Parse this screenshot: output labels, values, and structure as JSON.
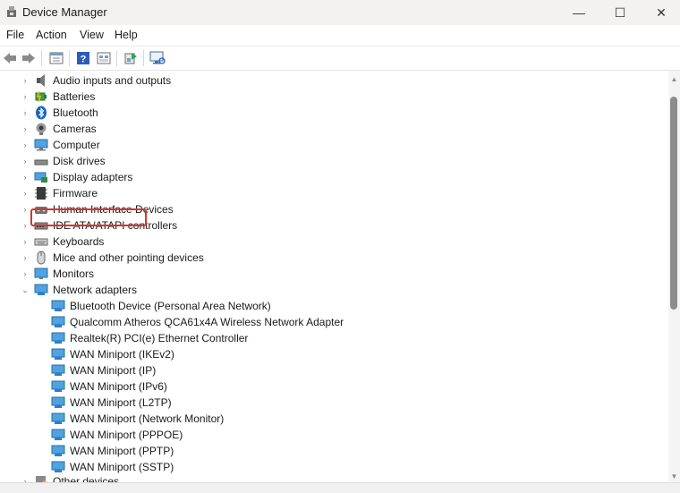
{
  "window": {
    "title": "Device Manager",
    "controls": {
      "minimize": "—",
      "maximize": "☐",
      "close": "✕"
    }
  },
  "menu": [
    "File",
    "Action",
    "View",
    "Help"
  ],
  "toolbar": {
    "buttons": [
      "back-arrow-icon",
      "forward-arrow-icon",
      "properties-icon",
      "help-icon",
      "show-hidden-icon",
      "update-driver-icon",
      "scan-hardware-icon"
    ]
  },
  "tree": {
    "categories": [
      {
        "label": "Audio inputs and outputs",
        "icon": "speaker-icon"
      },
      {
        "label": "Batteries",
        "icon": "battery-icon"
      },
      {
        "label": "Bluetooth",
        "icon": "bluetooth-icon"
      },
      {
        "label": "Cameras",
        "icon": "camera-icon"
      },
      {
        "label": "Computer",
        "icon": "computer-icon"
      },
      {
        "label": "Disk drives",
        "icon": "disk-drive-icon"
      },
      {
        "label": "Display adapters",
        "icon": "display-adapter-icon"
      },
      {
        "label": "Firmware",
        "icon": "firmware-icon"
      },
      {
        "label": "Human Interface Devices",
        "icon": "hid-icon"
      },
      {
        "label": "IDE ATA/ATAPI controllers",
        "icon": "ide-controller-icon"
      },
      {
        "label": "Keyboards",
        "icon": "keyboard-icon"
      },
      {
        "label": "Mice and other pointing devices",
        "icon": "mouse-icon"
      },
      {
        "label": "Monitors",
        "icon": "monitor-icon"
      },
      {
        "label": "Network adapters",
        "icon": "network-adapter-icon",
        "expanded": true,
        "selected": true
      }
    ],
    "network_children": [
      "Bluetooth Device (Personal Area Network)",
      "Qualcomm Atheros QCA61x4A Wireless Network Adapter",
      "Realtek(R) PCI(e) Ethernet Controller",
      "WAN Miniport (IKEv2)",
      "WAN Miniport (IP)",
      "WAN Miniport (IPv6)",
      "WAN Miniport (L2TP)",
      "WAN Miniport (Network Monitor)",
      "WAN Miniport (PPPOE)",
      "WAN Miniport (PPTP)",
      "WAN Miniport (SSTP)"
    ],
    "after": [
      {
        "label": "Other devices",
        "icon": "other-devices-icon"
      }
    ]
  },
  "colors": {
    "highlight": "#d2352e",
    "accent": "#1e88e5"
  }
}
